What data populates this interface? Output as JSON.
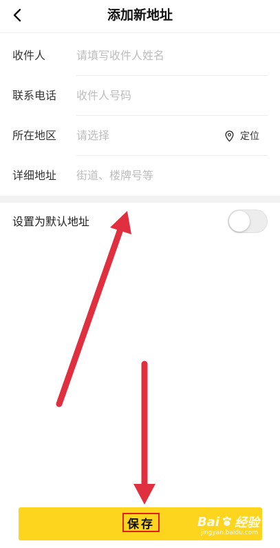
{
  "header": {
    "title": "添加新地址"
  },
  "form": {
    "rows": [
      {
        "label": "收件人",
        "placeholder": "请填写收件人姓名"
      },
      {
        "label": "联系电话",
        "placeholder": "收件人号码"
      },
      {
        "label": "所在地区",
        "placeholder": "请选择",
        "locate_label": "定位"
      },
      {
        "label": "详细地址",
        "placeholder": "街道、楼牌号等"
      }
    ]
  },
  "default_address": {
    "label": "设置为默认地址",
    "enabled": false
  },
  "footer": {
    "save_label": "保存"
  },
  "watermark": {
    "brand_left": "Bai",
    "brand_right": "经验",
    "url": "jingyan.baidu.com"
  },
  "colors": {
    "accent": "#fdd51f",
    "annotation": "#e03040",
    "placeholder": "#bdbdbd"
  },
  "icons": {
    "back": "chevron-left-icon",
    "locate": "map-pin-icon",
    "watermark": "paw-icon"
  }
}
